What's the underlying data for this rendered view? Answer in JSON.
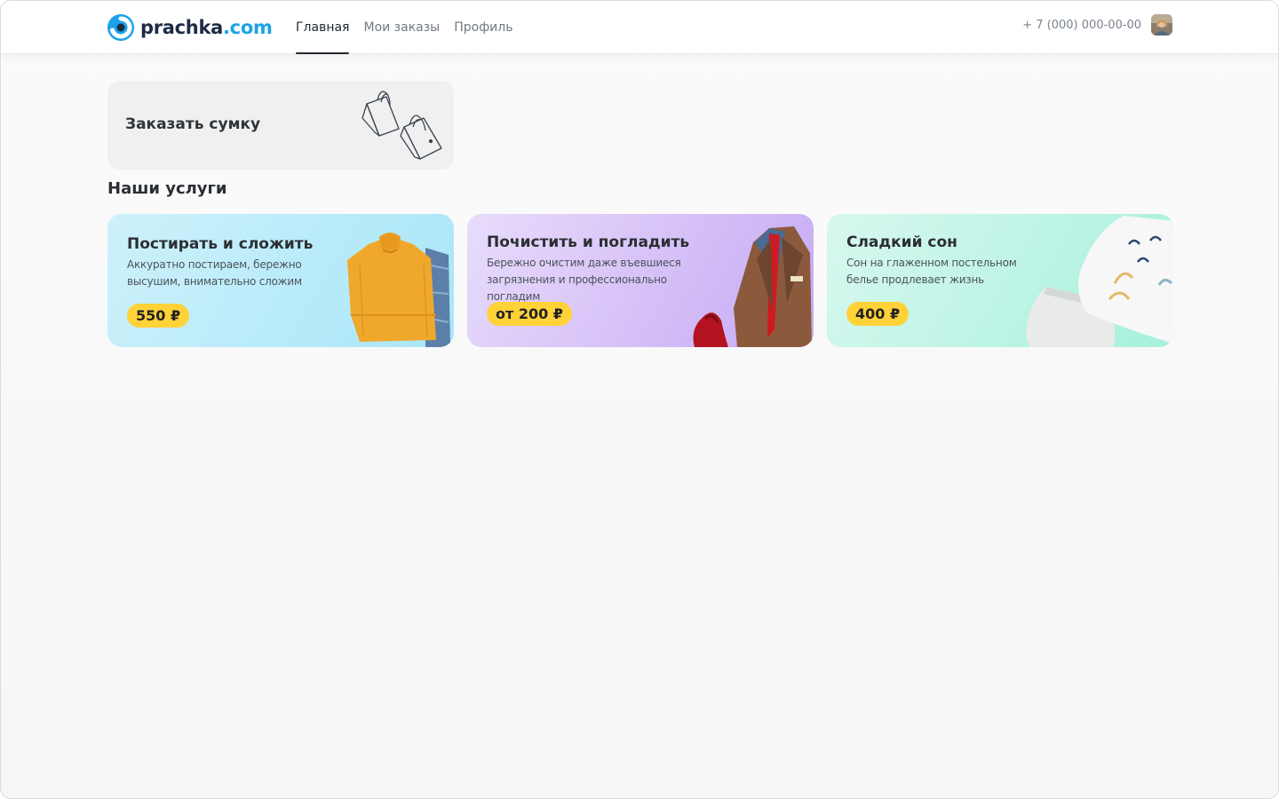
{
  "header": {
    "logo": {
      "part1": "prachka",
      "part2": ".com"
    },
    "nav": [
      {
        "label": "Главная",
        "active": true
      },
      {
        "label": "Мои заказы",
        "active": false
      },
      {
        "label": "Профиль",
        "active": false
      }
    ],
    "phone": "+ 7 (000) 000-00-00"
  },
  "order_bag": {
    "title": "Заказать сумку"
  },
  "services": {
    "title": "Наши услуги",
    "items": [
      {
        "title": "Постирать и сложить",
        "description": "Аккуратно постираем, бережно высушим, внимательно сложим",
        "price": "550 ₽"
      },
      {
        "title": "Почистить и погладить",
        "description": "Бережно очистим даже въевшиеся загрязнения и профессионально погладим",
        "price": "от 200 ₽"
      },
      {
        "title": "Сладкий сон",
        "description": "Сон на глаженном постельном белье продлевает жизнь",
        "price": "400 ₽"
      }
    ]
  },
  "colors": {
    "accent_yellow": "#ffd238",
    "brand_blue": "#1aa3e8",
    "brand_dark": "#1e2b46",
    "card_blue": "#a9e6f8",
    "card_purple": "#c6a9f4",
    "card_mint": "#a7f0dd"
  },
  "icons": [
    "logo-mark-icon",
    "avatar",
    "shopping-bags-icon"
  ]
}
